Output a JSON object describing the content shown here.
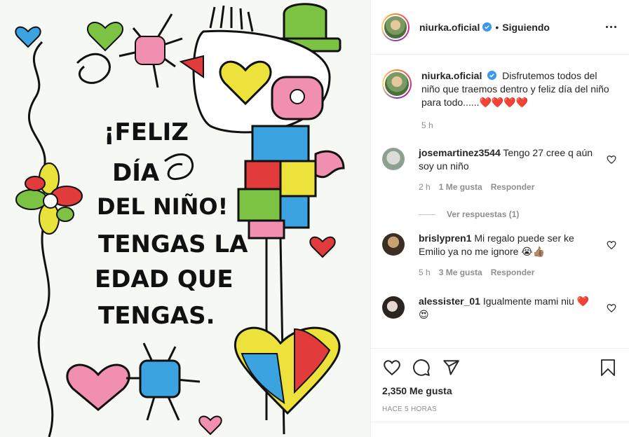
{
  "post": {
    "author": "niurka.oficial",
    "follow_status": "Siguiendo",
    "separator": "•",
    "image_text": {
      "line1": "¡FELIZ",
      "line2": "DÍA",
      "line3": "DEL NIÑO!",
      "line4": "TENGAS LA",
      "line5": "EDAD QUE",
      "line6": "TENGAS."
    }
  },
  "caption": {
    "user": "niurka.oficial",
    "text": "Disfrutemos todos del niño que traemos dentro y feliz día del niño para todo......❤️❤️❤️❤️",
    "time": "5 h"
  },
  "comments": [
    {
      "user": "josemartinez3544",
      "text": "Tengo 27 cree q aún soy un niño",
      "time": "2 h",
      "likes": "1 Me gusta",
      "reply": "Responder",
      "view_replies": "Ver respuestas (1)"
    },
    {
      "user": "brislypren1",
      "text": "Mi regalo puede ser ke Emilio ya no me ignore 😭👍🏽",
      "time": "5 h",
      "likes": "3 Me gusta",
      "reply": "Responder"
    },
    {
      "user": "alessister_01",
      "text": "Igualmente mami niu ❤️😍"
    }
  ],
  "footer": {
    "likes": "2,350 Me gusta",
    "time_ago": "HACE 5 HORAS"
  },
  "icons": {
    "verified": "verified-badge-icon",
    "more": "more-options-icon",
    "like": "heart-icon",
    "comment": "comment-icon",
    "share": "send-icon",
    "save": "bookmark-icon"
  },
  "colors": {
    "text": "#262626",
    "muted": "#8e8e8e",
    "verified": "#3897f0",
    "border": "#efefef"
  }
}
